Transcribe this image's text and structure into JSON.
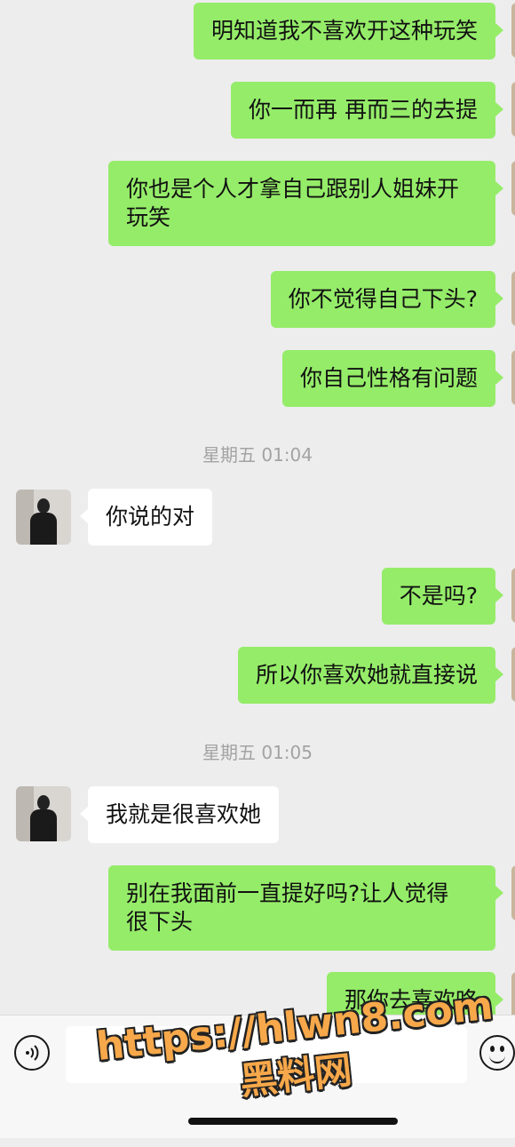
{
  "messages": [
    {
      "type": "text",
      "from": "me",
      "text": "明知道我不喜欢开这种玩笑"
    },
    {
      "type": "text",
      "from": "me",
      "text": "你一而再 再而三的去提"
    },
    {
      "type": "text",
      "from": "me",
      "text": "你也是个人才拿自己跟别人姐妹开\n玩笑"
    },
    {
      "type": "text",
      "from": "me",
      "text": "你不觉得自己下头?"
    },
    {
      "type": "text",
      "from": "me",
      "text": "你自己性格有问题"
    },
    {
      "type": "time",
      "text": "星期五 01:04"
    },
    {
      "type": "text",
      "from": "other",
      "text": "你说的对"
    },
    {
      "type": "text",
      "from": "me",
      "text": "不是吗?"
    },
    {
      "type": "text",
      "from": "me",
      "text": "所以你喜欢她就直接说"
    },
    {
      "type": "time",
      "text": "星期五 01:05"
    },
    {
      "type": "text",
      "from": "other",
      "text": "我就是很喜欢她"
    },
    {
      "type": "text",
      "from": "me",
      "text": "别在我面前一直提好吗?让人觉得\n很下头"
    },
    {
      "type": "text",
      "from": "me",
      "text": "那你去喜欢咯"
    }
  ],
  "input_bar": {
    "voice_icon": "voice-icon",
    "emoji_icon": "emoji-icon",
    "input_value": ""
  },
  "watermark": {
    "url": "https://hlwn8.com",
    "name": "黑料网"
  },
  "colors": {
    "background": "#ededed",
    "my_bubble": "#95ec69",
    "other_bubble": "#ffffff",
    "timestamp": "#a3a3a3"
  }
}
